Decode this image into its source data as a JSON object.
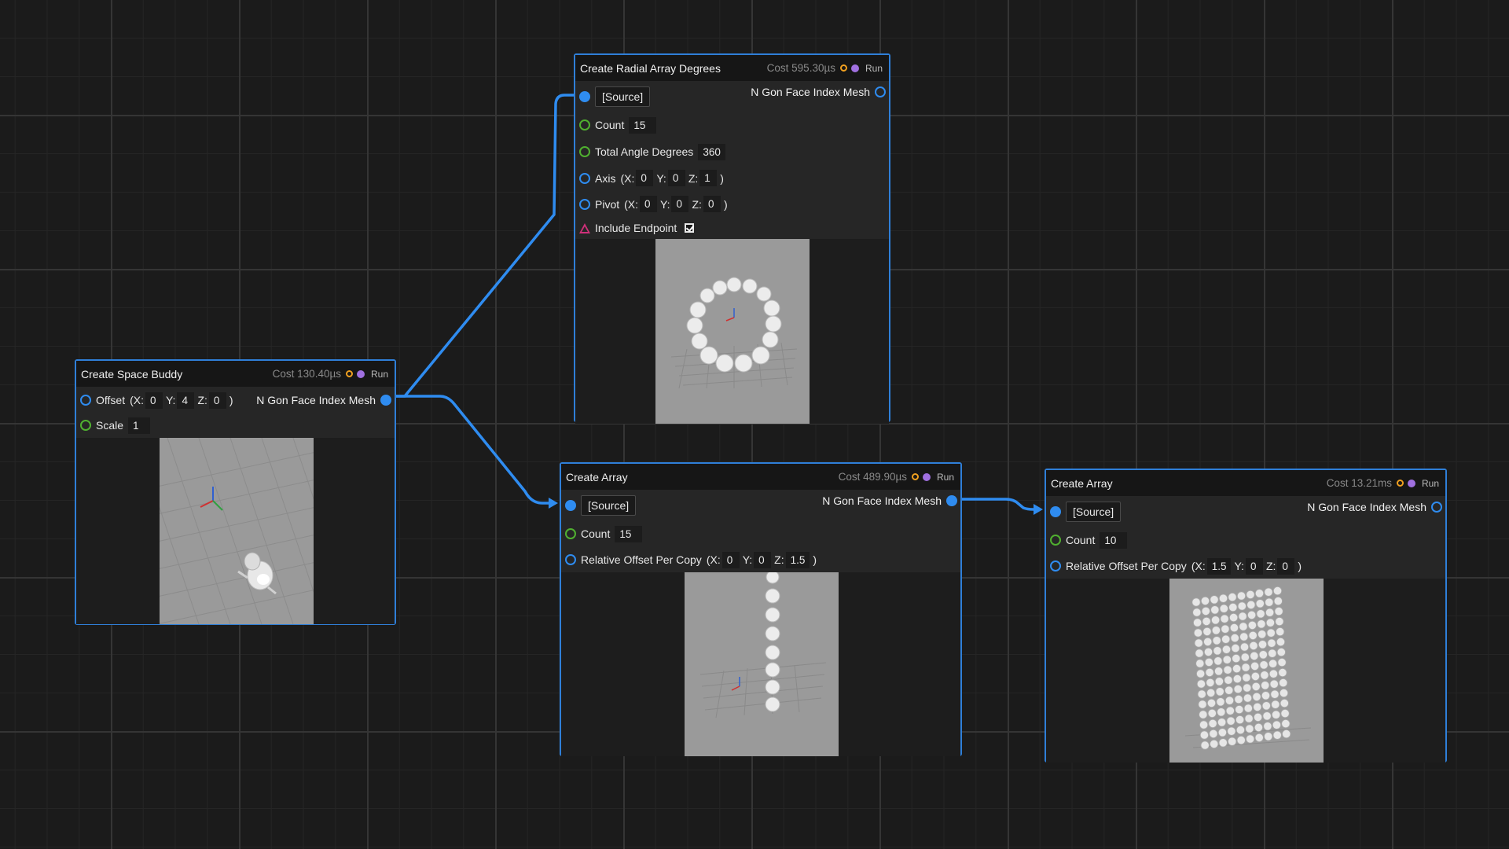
{
  "colors": {
    "accent": "#2f7fd8",
    "wire": "#2f8cf0",
    "pin_green": "#50b030",
    "pin_pink": "#d0307a",
    "dot_orange": "#f0a020",
    "dot_purple": "#a070e0"
  },
  "space_buddy": {
    "title": "Create Space Buddy",
    "cost": "Cost 130.40µs",
    "run": "Run",
    "output": "N Gon Face Index Mesh",
    "offset_label": "Offset",
    "offset_open": "(X:",
    "offset_x": "0",
    "y_label": "Y:",
    "offset_y": "4",
    "z_label": "Z:",
    "offset_z": "0",
    "close": ")",
    "scale_label": "Scale",
    "scale": "1"
  },
  "radial": {
    "title": "Create Radial Array Degrees",
    "cost": "Cost 595.30µs",
    "run": "Run",
    "source": "[Source]",
    "output": "N Gon Face Index Mesh",
    "count_label": "Count",
    "count": "15",
    "angle_label": "Total Angle Degrees",
    "angle": "360",
    "axis_label": "Axis",
    "axis_open": "(X:",
    "axis_x": "0",
    "y_label": "Y:",
    "axis_y": "0",
    "z_label": "Z:",
    "axis_z": "1",
    "close": ")",
    "pivot_label": "Pivot",
    "pivot_open": "(X:",
    "pivot_x": "0",
    "pivot_y": "0",
    "pivot_z": "0",
    "endpoint_label": "Include Endpoint",
    "endpoint_checked": true
  },
  "array1": {
    "title": "Create Array",
    "cost": "Cost 489.90µs",
    "run": "Run",
    "source": "[Source]",
    "output": "N Gon Face Index Mesh",
    "count_label": "Count",
    "count": "15",
    "offset_label": "Relative Offset Per Copy",
    "offset_open": "(X:",
    "offset_x": "0",
    "y_label": "Y:",
    "offset_y": "0",
    "z_label": "Z:",
    "offset_z": "1.5",
    "close": ")"
  },
  "array2": {
    "title": "Create Array",
    "cost": "Cost 13.21ms",
    "run": "Run",
    "source": "[Source]",
    "output": "N Gon Face Index Mesh",
    "count_label": "Count",
    "count": "10",
    "offset_label": "Relative Offset Per Copy",
    "offset_open": "(X:",
    "offset_x": "1.5",
    "y_label": "Y:",
    "offset_y": "0",
    "z_label": "Z:",
    "offset_z": "0",
    "close": ")"
  }
}
